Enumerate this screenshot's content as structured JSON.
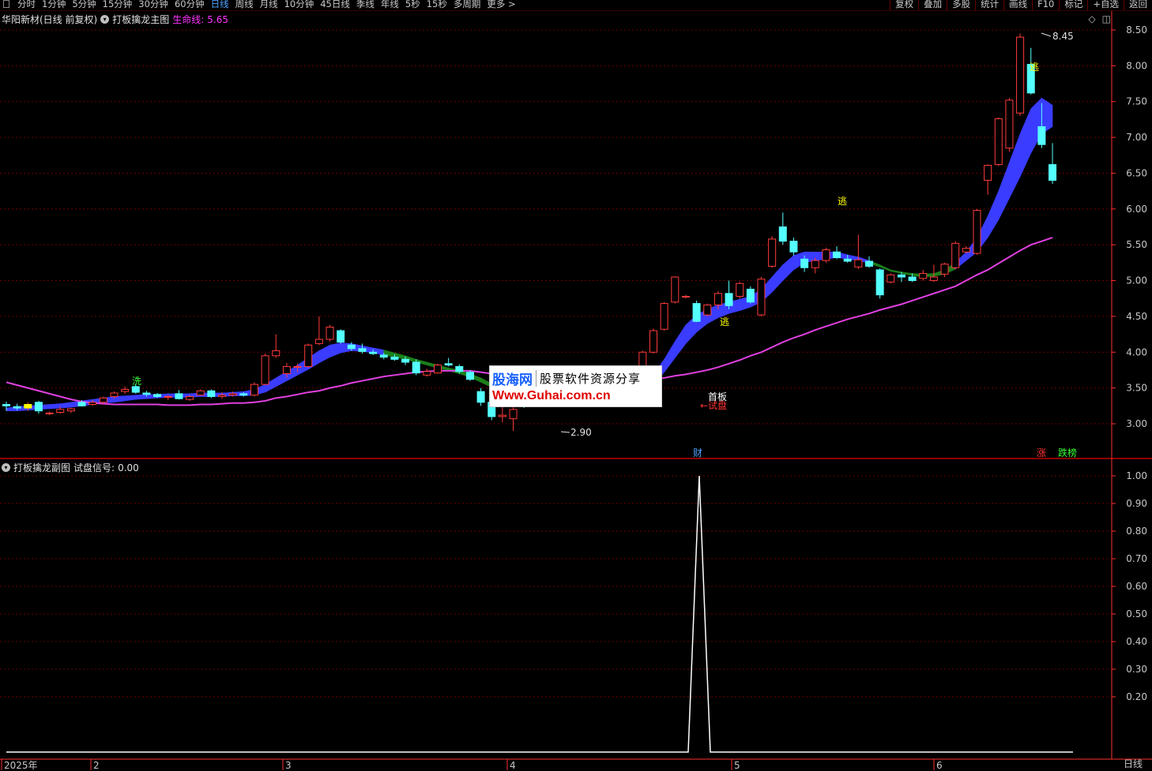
{
  "toolbar": {
    "periods": [
      "分时",
      "1分钟",
      "5分钟",
      "15分钟",
      "30分钟",
      "60分钟",
      "日线",
      "周线",
      "月线",
      "10分钟",
      "45日线",
      "季线",
      "年线",
      "5秒",
      "15秒",
      "多周期"
    ],
    "active": "日线",
    "more": "更多 >",
    "right_buttons": [
      "复权",
      "叠加",
      "多股",
      "统计",
      "画线",
      "F10",
      "标记",
      "+自选",
      "返回"
    ]
  },
  "main_header": {
    "stock": "华阳新材(日线 前复权)",
    "indicator": "打板擒龙主图",
    "life_label": "生命线:",
    "life_value": "5.65"
  },
  "sub_header": {
    "indicator": "打板擒龙副图",
    "signal_label": "试盘信号:",
    "signal_value": "0.00"
  },
  "main_axis_ticks": [
    "8.50",
    "8.00",
    "7.50",
    "7.00",
    "6.50",
    "6.00",
    "5.50",
    "5.00",
    "4.50",
    "4.00",
    "3.50",
    "3.00"
  ],
  "sub_axis_ticks": [
    "1.00",
    "0.90",
    "0.80",
    "0.70",
    "0.60",
    "0.50",
    "0.40",
    "0.30",
    "0.20"
  ],
  "date_axis": [
    "2025年",
    "2",
    "3",
    "4",
    "5",
    "6"
  ],
  "annotations": {
    "high": "8.45",
    "low": "2.90",
    "xi": "洗",
    "tao": "逃",
    "shouban": "首板",
    "shipan": "试盘",
    "cai": "财",
    "zhang": "涨",
    "diebang": "跌榜"
  },
  "watermark": {
    "logo": "股海网",
    "slogan": "股票软件资源分享",
    "url": "Www.Guhai.com.cn"
  },
  "period_label": "日线",
  "colors": {
    "up": "#ff3b3b",
    "down": "#54ffff",
    "ribbon_up": "#3a3cff",
    "ribbon_down": "#1b7f1b",
    "life": "#e040e0",
    "grid": "#6b0000",
    "axis": "#ff3030"
  }
}
